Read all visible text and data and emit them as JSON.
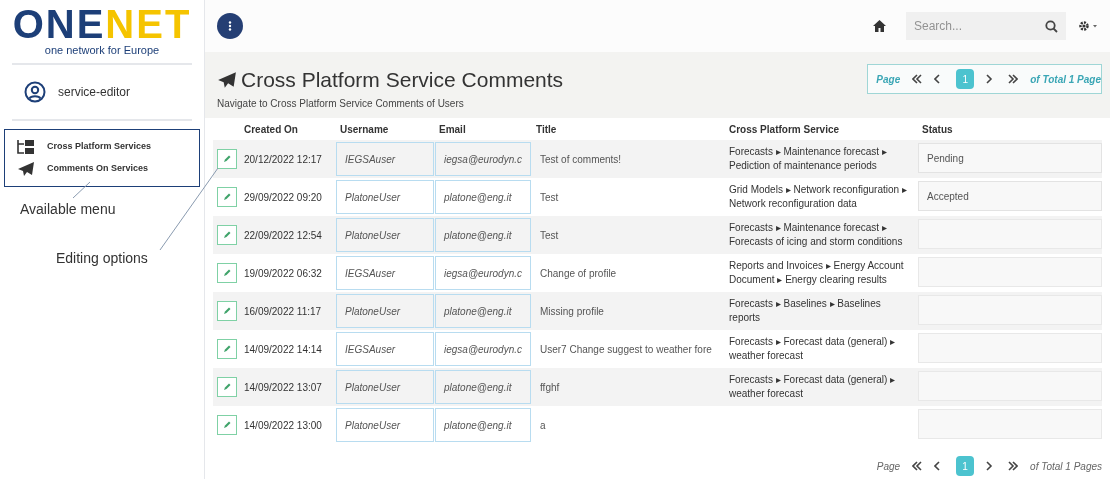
{
  "sidebar": {
    "logo": {
      "lead": "ONE",
      "rest": "NET",
      "tagline": "one network for Europe"
    },
    "user": "service-editor",
    "menu": [
      {
        "kind": "folders",
        "label": "Cross Platform Services"
      },
      {
        "kind": "plane",
        "label": "Comments On Services"
      }
    ]
  },
  "annotations": [
    {
      "kind": "menu",
      "text": "Available menu"
    },
    {
      "kind": "edit",
      "text": "Editing options"
    }
  ],
  "topbar": {
    "search": {
      "placeholder": "Search..."
    }
  },
  "header": {
    "title": "Cross Platform Service Comments",
    "subtitle": "Navigate to Cross Platform Service Comments of Users"
  },
  "pager_top": {
    "page_label": "Page",
    "current": "1",
    "total_label": "of Total 1 Page"
  },
  "table": {
    "columns": [
      "Created On",
      "Username",
      "Email",
      "Title",
      "Cross Platform Service",
      "Status"
    ],
    "rows": [
      {
        "created_on": "20/12/2022 12:17",
        "username": "IEGSAuser",
        "email": "iegsa@eurodyn.c",
        "title": "Test of comments!",
        "service": "Forecasts ▸ Maintenance forecast ▸ Pediction of maintenance periods",
        "status": "Pending"
      },
      {
        "created_on": "29/09/2022 09:20",
        "username": "PlatoneUser",
        "email": "platone@eng.it",
        "title": "Test",
        "service": "Grid Models ▸ Network reconfiguration ▸ Network reconfiguration data",
        "status": "Accepted"
      },
      {
        "created_on": "22/09/2022 12:54",
        "username": "PlatoneUser",
        "email": "platone@eng.it",
        "title": "Test",
        "service": "Forecasts ▸ Maintenance forecast ▸ Forecasts of icing and storm conditions"
      },
      {
        "created_on": "19/09/2022 06:32",
        "username": "IEGSAuser",
        "email": "iegsa@eurodyn.c",
        "title": "Change of profile",
        "service": "Reports and Invoices ▸ Energy Account Document ▸ Energy clearing results"
      },
      {
        "created_on": "16/09/2022 11:17",
        "username": "PlatoneUser",
        "email": "platone@eng.it",
        "title": "Missing profile",
        "service": "Forecasts ▸ Baselines ▸ Baselines reports"
      },
      {
        "created_on": "14/09/2022 14:14",
        "username": "IEGSAuser",
        "email": "iegsa@eurodyn.c",
        "title": "User7 Change suggest to weather fore",
        "service": "Forecasts ▸ Forecast data (general) ▸ weather forecast"
      },
      {
        "created_on": "14/09/2022 13:07",
        "username": "PlatoneUser",
        "email": "platone@eng.it",
        "title": "ffghf",
        "service": "Forecasts ▸ Forecast data (general) ▸ weather forecast"
      },
      {
        "created_on": "14/09/2022 13:00",
        "username": "PlatoneUser",
        "email": "platone@eng.it",
        "title": "a"
      }
    ]
  },
  "pager_bottom": {
    "page_label": "Page",
    "current": "1",
    "total_label": "of Total 1 Pages"
  }
}
